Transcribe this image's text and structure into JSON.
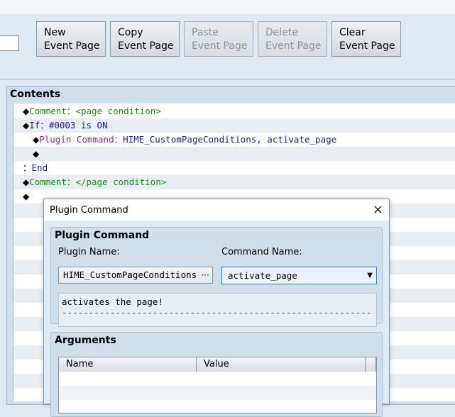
{
  "toolbar": {
    "buttons": [
      {
        "line1": "New",
        "line2": "Event Page",
        "enabled": true
      },
      {
        "line1": "Copy",
        "line2": "Event Page",
        "enabled": true
      },
      {
        "line1": "Paste",
        "line2": "Event Page",
        "enabled": false
      },
      {
        "line1": "Delete",
        "line2": "Event Page",
        "enabled": false
      },
      {
        "line1": "Clear",
        "line2": "Event Page",
        "enabled": true
      }
    ]
  },
  "contents": {
    "title": "Contents",
    "rows": [
      {
        "marker": "◆",
        "cmd": "Comment",
        "sep": "：",
        "text": "<page condition>"
      },
      {
        "marker": "◆",
        "cmd": "If",
        "sep": "：",
        "text": "#0003 is ON"
      },
      {
        "marker": "◆",
        "cmd": "Plugin Command",
        "sep": "：",
        "text": "HIME_CustomPageConditions, activate_page"
      },
      {
        "marker": "◆"
      },
      {
        "marker": "",
        "cmd": "：",
        "text": "End"
      },
      {
        "marker": "◆",
        "cmd": "Comment",
        "sep": "：",
        "text": "</page condition>"
      },
      {
        "marker": "◆"
      }
    ]
  },
  "dialog": {
    "title": "Plugin Command",
    "close_icon": "×",
    "group_plugin": {
      "title": "Plugin Command",
      "plugin_name_label": "Plugin Name:",
      "plugin_name_value": "HIME_CustomPageConditions",
      "plugin_name_button": "···",
      "command_name_label": "Command Name:",
      "command_name_value": "activate_page",
      "dropdown_icon": "▼",
      "description": "activates the page!",
      "description_rule": "--------------------------------------------------------------"
    },
    "group_args": {
      "title": "Arguments",
      "col_name": "Name",
      "col_value": "Value"
    }
  }
}
